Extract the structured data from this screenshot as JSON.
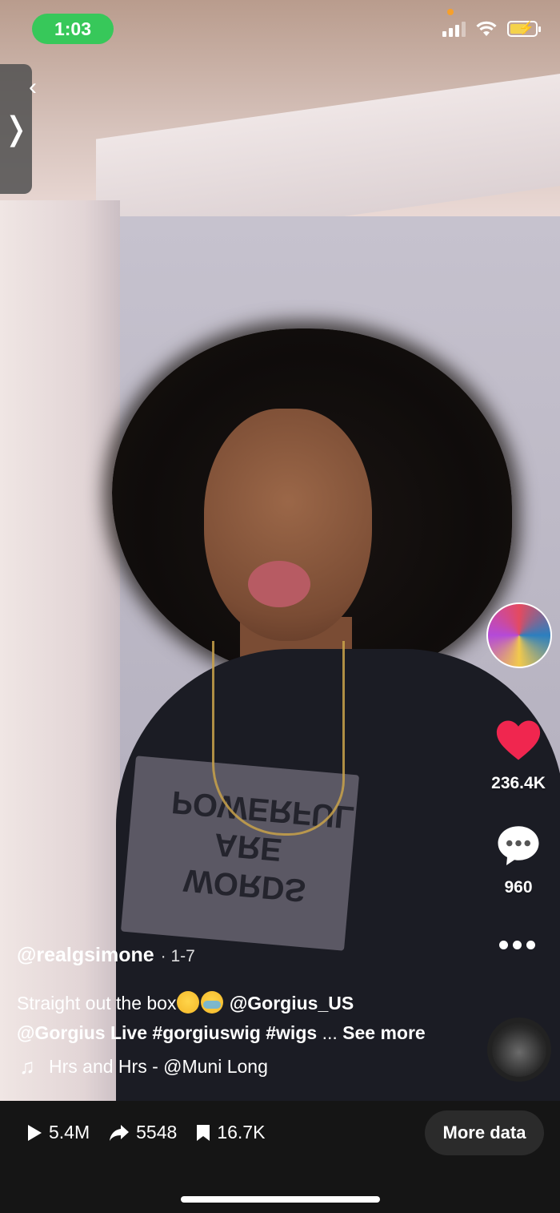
{
  "status_bar": {
    "time": "1:03"
  },
  "video": {
    "shirt_print": [
      "WORDS",
      "ARE",
      "POWERFUL"
    ]
  },
  "creator": {
    "avatar_icon": "creator-avatar"
  },
  "actions": {
    "like_count": "236.4K",
    "comment_count": "960",
    "like_color": "#f0264f"
  },
  "post": {
    "username": "@realgsimone",
    "date": "· 1-7",
    "caption_text_1": "Straight out the box",
    "mention_1": "@Gorgius_US",
    "mention_2": "@Gorgius Live",
    "hashtags": "#gorgiuswig #wigs",
    "ellipsis": "...",
    "see_more": "See more",
    "sound": "Hrs and Hrs - @Muni Long"
  },
  "stats": {
    "plays": "5.4M",
    "shares": "5548",
    "saves": "16.7K"
  },
  "bottom": {
    "more_data_label": "More data"
  }
}
